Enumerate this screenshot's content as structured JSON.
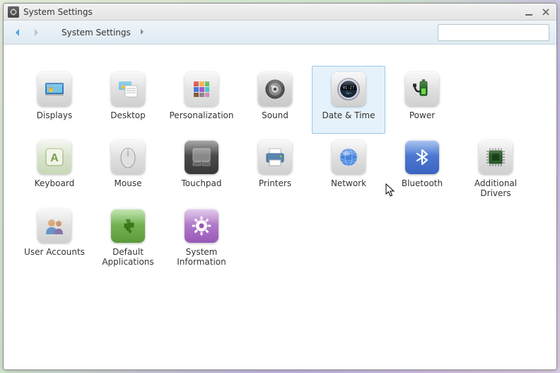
{
  "window": {
    "title": "System Settings"
  },
  "toolbar": {
    "breadcrumb": "System Settings",
    "search_placeholder": ""
  },
  "items": [
    {
      "id": "displays",
      "label": "Displays",
      "icon": "displays",
      "selected": false
    },
    {
      "id": "desktop",
      "label": "Desktop",
      "icon": "desktop",
      "selected": false
    },
    {
      "id": "personalization",
      "label": "Personalization",
      "icon": "personalization",
      "selected": false
    },
    {
      "id": "sound",
      "label": "Sound",
      "icon": "sound",
      "selected": false
    },
    {
      "id": "date-time",
      "label": "Date & Time",
      "icon": "datetime",
      "selected": true
    },
    {
      "id": "power",
      "label": "Power",
      "icon": "power",
      "selected": false
    },
    {
      "id": "keyboard",
      "label": "Keyboard",
      "icon": "keyboard",
      "selected": false
    },
    {
      "id": "mouse",
      "label": "Mouse",
      "icon": "mouse",
      "selected": false
    },
    {
      "id": "touchpad",
      "label": "Touchpad",
      "icon": "touchpad",
      "selected": false
    },
    {
      "id": "printers",
      "label": "Printers",
      "icon": "printers",
      "selected": false
    },
    {
      "id": "network",
      "label": "Network",
      "icon": "network",
      "selected": false
    },
    {
      "id": "bluetooth",
      "label": "Bluetooth",
      "icon": "bluetooth",
      "selected": false
    },
    {
      "id": "additional-drivers",
      "label": "Additional Drivers",
      "icon": "drivers",
      "selected": false
    },
    {
      "id": "user-accounts",
      "label": "User Accounts",
      "icon": "users",
      "selected": false
    },
    {
      "id": "default-applications",
      "label": "Default Applications",
      "icon": "defaultapps",
      "selected": false
    },
    {
      "id": "system-information",
      "label": "System Information",
      "icon": "sysinfo",
      "selected": false
    }
  ],
  "row_offsets": [
    0,
    0,
    0
  ],
  "datetime_icon": {
    "line1": "01:27",
    "line2": "Sun"
  }
}
